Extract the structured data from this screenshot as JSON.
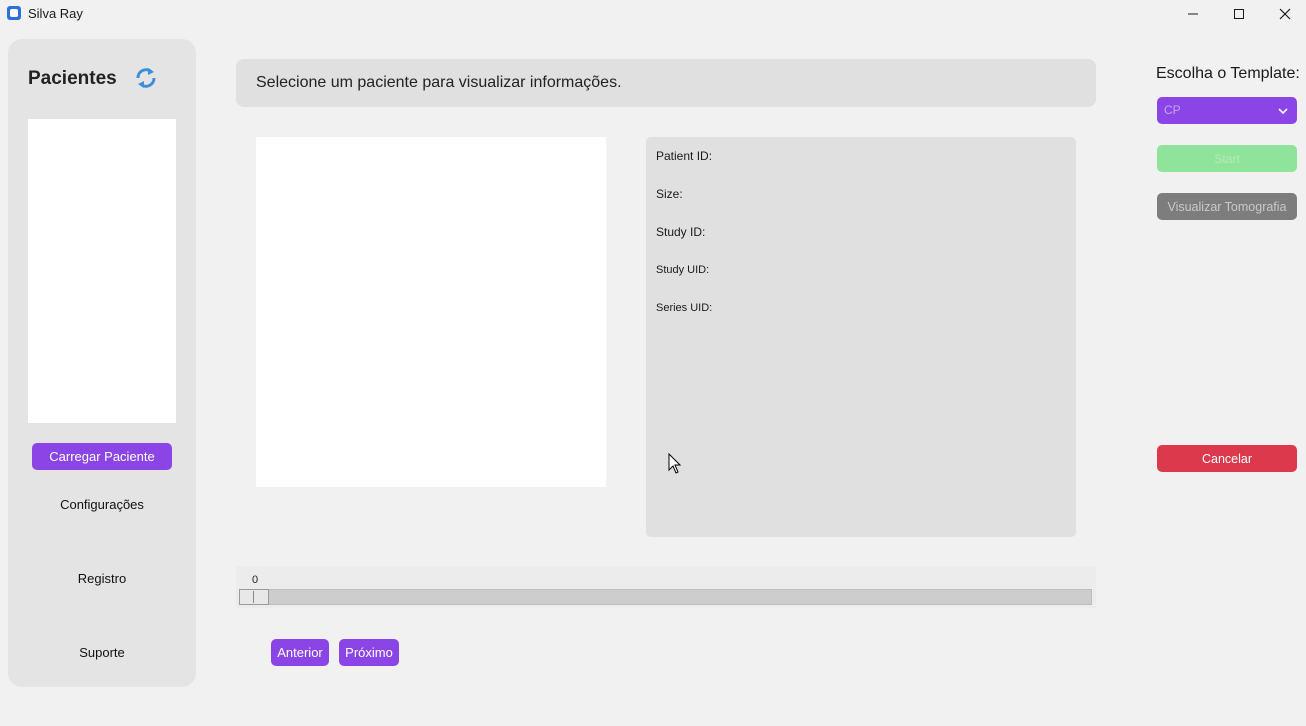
{
  "window": {
    "title": "Silva Ray",
    "controls": {
      "minimize": "—",
      "maximize": "☐",
      "close": "✕"
    }
  },
  "sidebar": {
    "title": "Pacientes",
    "refresh_icon": "refresh-icon",
    "load_button": "Carregar Paciente",
    "links": [
      "Configurações",
      "Registro",
      "Suporte"
    ]
  },
  "main": {
    "banner_text": "Selecione um paciente para visualizar informações.",
    "details": {
      "patient_id": "Patient ID:",
      "size": "Size:",
      "study_id": "Study ID:",
      "study_uid": "Study UID:",
      "series_uid": "Series UID:"
    },
    "slider": {
      "value": "0"
    },
    "prev_button": "Anterior",
    "next_button": "Próximo"
  },
  "right_panel": {
    "template_label": "Escolha o Template:",
    "template_selected": "CP",
    "start_button": "Start",
    "view_tomography_button": "Visualizar Tomografia",
    "cancel_button": "Cancelar"
  },
  "colors": {
    "accent": "#8b45e6",
    "start": "#8fe39a",
    "disabled": "#7d7d7d",
    "danger": "#dc3a4c",
    "refresh": "#3a8fd8"
  }
}
